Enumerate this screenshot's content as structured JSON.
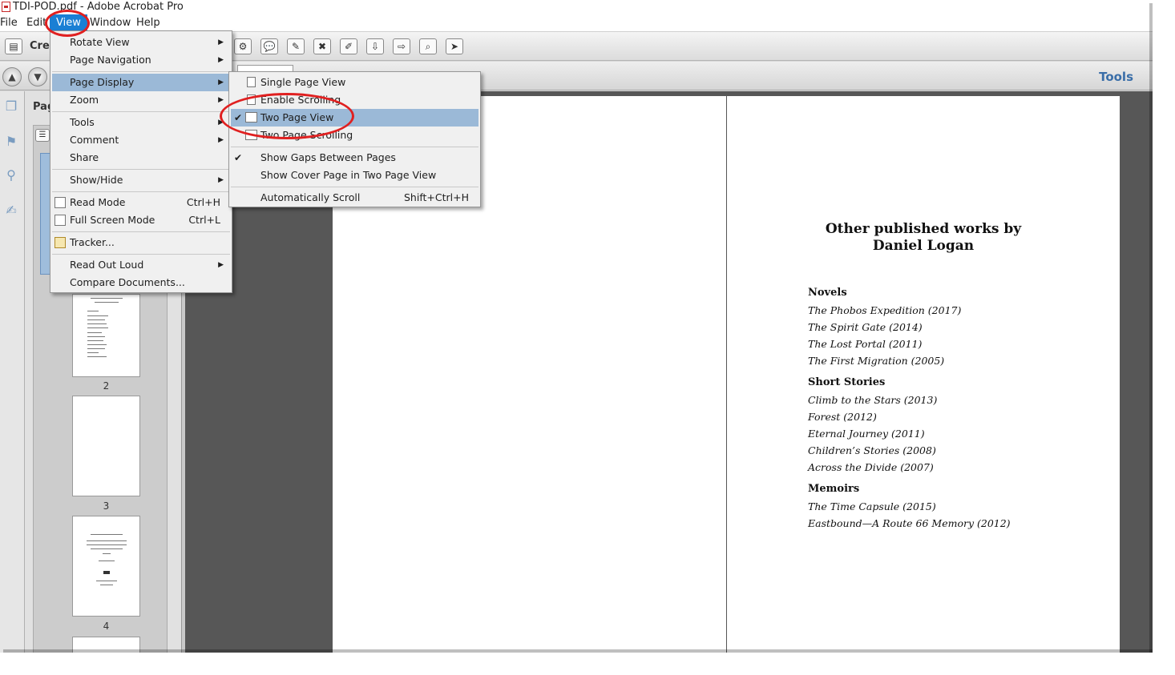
{
  "window": {
    "title": "TDI-POD.pdf - Adobe Acrobat Pro"
  },
  "menubar": {
    "items": [
      {
        "label": "File"
      },
      {
        "label": "Edit"
      },
      {
        "label": "View"
      },
      {
        "label": "Window"
      },
      {
        "label": "Help"
      }
    ]
  },
  "toolbar": {
    "create_label": "Crea",
    "tools_label": "Tools"
  },
  "navpane": {
    "title": "Pag",
    "thumb_numbers": [
      "2",
      "3",
      "4"
    ]
  },
  "view_menu": {
    "items": [
      {
        "label": "Rotate View",
        "submenu": true
      },
      {
        "label": "Page Navigation",
        "submenu": true
      },
      {
        "label": "Page Display",
        "submenu": true,
        "highlighted": true
      },
      {
        "label": "Zoom",
        "submenu": true
      },
      {
        "label": "Tools",
        "submenu": true
      },
      {
        "label": "Comment",
        "submenu": true
      },
      {
        "label": "Share",
        "submenu": false
      },
      {
        "label": "Show/Hide",
        "submenu": true
      },
      {
        "label": "Read Mode",
        "shortcut": "Ctrl+H"
      },
      {
        "label": "Full Screen Mode",
        "shortcut": "Ctrl+L"
      },
      {
        "label": "Tracker..."
      },
      {
        "label": "Read Out Loud",
        "submenu": true
      },
      {
        "label": "Compare Documents..."
      }
    ]
  },
  "page_display_menu": {
    "items": [
      {
        "label": "Single Page View"
      },
      {
        "label": "Enable Scrolling"
      },
      {
        "label": "Two Page View",
        "checked": true,
        "highlighted": true
      },
      {
        "label": "Two Page Scrolling"
      },
      {
        "label": "Show Gaps Between Pages",
        "checked": true
      },
      {
        "label": "Show Cover Page in Two Page View"
      },
      {
        "label": "Automatically Scroll",
        "shortcut": "Shift+Ctrl+H"
      }
    ]
  },
  "document": {
    "title_line1": "Other published works by",
    "title_line2": "Daniel Logan",
    "sections": [
      {
        "heading": "Novels",
        "works": [
          "The Phobos Expedition (2017)",
          "The Spirit Gate (2014)",
          "The Lost Portal (2011)",
          "The First Migration (2005)"
        ]
      },
      {
        "heading": "Short Stories",
        "works": [
          "Climb to the Stars (2013)",
          "Forest (2012)",
          "Eternal Journey (2011)",
          "Children’s Stories (2008)",
          "Across the Divide (2007)"
        ]
      },
      {
        "heading": "Memoirs",
        "works": [
          "The Time Capsule (2015)",
          "Eastbound—A Route 66 Memory (2012)"
        ]
      }
    ]
  },
  "colors": {
    "menu_active": "#1a7fd4",
    "menu_highlight": "#9bb9d7",
    "annotation_ring": "#e02020",
    "doc_background": "#575757"
  }
}
